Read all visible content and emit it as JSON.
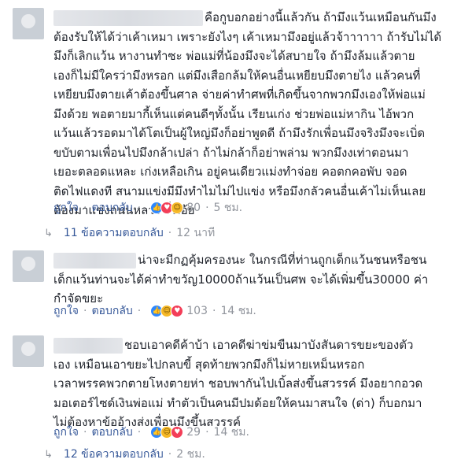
{
  "comments": [
    {
      "lines": [
        "คือกูบอกอย่างนี้แล้วกัน ถ้ามึงแว้นเหมือนกันมึง",
        "ต้องรับให้ได้ว่าเค้าเหมา เพราะยังไงๆ เค้าเหมามึงอยู่แล้วจ้าาาาาา ถ้ารับไม่ได้",
        "มึงก็เลิกแว้น หางานทำซะ พ่อแม่ที่น้องมึงจะได้สบายใจ ถ้ามึงล้มแล้วตาย",
        "เองก็ไม่มีใครว่ามึงหรอก แต่มึงเสือกล้มให้คนอื่นเหยียบมึงตายไง แล้วคนที่",
        "เหยียบมึงตายเค้าต้องขึ้นศาล จ่ายค่าทำศพที่เกิดขึ้นจากพวกมึงเองให้พ่อแม่",
        "มึงด้วย พอตายมากี้เห็นแต่คนดีๆทั้งนั้น เรียนเก่ง ช่วยพ่อแม่หากิน ไอ้พวก",
        "แว้นแล้วรอดมาได้โตเป็นผู้ใหญ่มึงก็อย่าพูดดี ถ้ามึงรักเพื่อนมึงจริงมึงจะเบิ่ด",
        "ขบับตามเพื่อนไปมึงกล้าเปล่า ถ้าไม่กล้าก็อย่าพล่าม พวกมึงงเท่าตอนมา",
        "เยอะตลอดแหละ เก่งเหลือเกิน อยู่คนเดียวแม่งทำจ่อย คอตกคอพับ จอด",
        "ติดไฟแดงที สนามแข่งมีมึงทำไมไม่ไปแข่ง หรือมึงกลัวคนอื่นเค้าไม่เห็นเลย",
        "ต้องมาแข่งถนนหลวง งั้วเอ้ย"
      ],
      "like": "ถูกใจ",
      "reply": "ตอบกลับ",
      "reaction_count": "80",
      "time": "5 ชม.",
      "replies_text": "11 ข้อความตอบกลับ",
      "replies_time": "12 นาที"
    },
    {
      "lines": [
        "น่าจะมีกฏคุ้มครองนะ ในกรณีที่ท่านถูกเด็กแว้นชนหรือชน",
        "เด็กแว้นท่านจะได้ค่าทำขวัญ10000ถ้าแว้นเป็นศพ จะได้เพิ่มขึ้น30000 ค่า",
        "กำจัดขยะ"
      ],
      "like": "ถูกใจ",
      "reply": "ตอบกลับ",
      "reaction_count": "103",
      "time": "14 ชม."
    },
    {
      "lines": [
        "ชอบเอาคดีค้าบ้า เอาคดีฆ่าข่มขืนมาบังสันดารขยะของตัว",
        "เอง เหมือนเอาขยะไปกลบขี้ สุดท้ายพวกมึงก็ไม่หายเหม็นหรอก",
        "เวลาพรรคพวกตายโหงตายห่า ชอบพากันไปเบิ้ลส่งขึ้นสวรรค์ มึงอยากอวด",
        "มอเตอร์ไซด์เงินพ่อแม่ ทำตัวเป็นคนมีปมด้อยให้คนมาสนใจ (ด่า) ก็บอกมา",
        "ไม่ต้องหาข้ออ้างส่งเพื่อนมึงขึ้นสวรรค์"
      ],
      "like": "ถูกใจ",
      "reply": "ตอบกลับ",
      "reaction_count": "29",
      "time": "14 ชม.",
      "replies_text": "12 ข้อความตอบกลับ",
      "replies_time": "2 ชม."
    }
  ]
}
